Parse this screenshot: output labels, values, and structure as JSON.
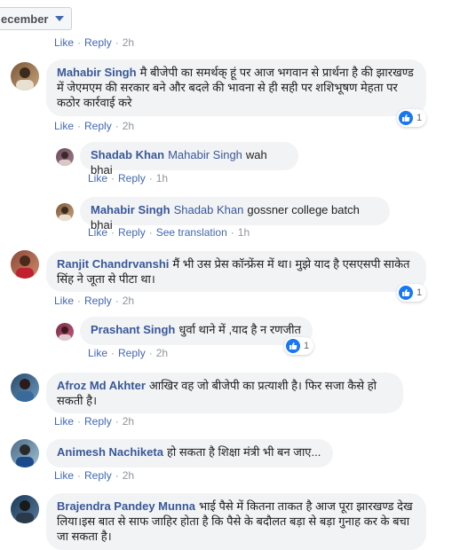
{
  "filter": {
    "label": "ecember"
  },
  "top_actions": {
    "like": "Like",
    "reply": "Reply",
    "time": "2h"
  },
  "comments": [
    {
      "author": "Mahabir Singh",
      "text": "मै बीजेपी का समर्थक् हूं पर आज भगवान से प्रार्थना है की झारखण्ड में जेएमएम की सरकार बने और बदले की भावना से ही सही पर शशिभूषण मेहता पर कठोर कार्रवाई करे",
      "like": "Like",
      "reply": "Reply",
      "time": "2h",
      "reactions": "1",
      "replies": [
        {
          "author": "Shadab Khan",
          "mention": "Mahabir Singh",
          "text": "wah bhai",
          "like": "Like",
          "reply": "Reply",
          "time": "1h"
        },
        {
          "author": "Mahabir Singh",
          "mention": "Shadab Khan",
          "text": "gossner college batch bhai",
          "like": "Like",
          "reply": "Reply",
          "translate": "See translation",
          "time": "1h"
        }
      ]
    },
    {
      "author": "Ranjit Chandrvanshi",
      "text": "मैं भी उस प्रेस कॉन्फ्रेंस में था। मुझे याद है एसएसपी साकेत सिंह ने जूता से पीटा था।",
      "like": "Like",
      "reply": "Reply",
      "time": "2h",
      "reactions": "1",
      "replies": [
        {
          "author": "Prashant Singh",
          "text": "धुर्वा थाने में ,याद है न रणजीत",
          "like": "Like",
          "reply": "Reply",
          "time": "2h",
          "reactions": "1"
        }
      ]
    },
    {
      "author": "Afroz Md Akhter",
      "text": "आखिर वह जो बीजेपी का प्रत्याशी है। फिर सजा कैसे हो सकती है।",
      "like": "Like",
      "reply": "Reply",
      "time": "2h"
    },
    {
      "author": "Animesh Nachiketa",
      "text": "हो सकता है शिक्षा मंत्री भी बन जाए...",
      "like": "Like",
      "reply": "Reply",
      "time": "2h"
    },
    {
      "author": "Brajendra Pandey Munna",
      "text": "भाई पैसे में कितना ताकत है आज पूरा झारखण्ड देख लिया।इस बात से साफ जाहिर होता है कि पैसे के बदौलत बड़ा से बड़ा गुनाह कर के बचा जा सकता है।"
    }
  ],
  "dot": "·"
}
